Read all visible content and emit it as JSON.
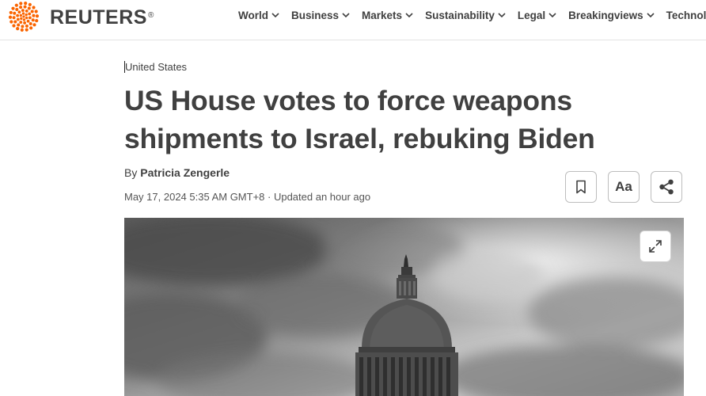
{
  "brand": {
    "name": "REUTERS",
    "registered_mark": "®",
    "accent_color": "#fa6400"
  },
  "nav": {
    "items": [
      {
        "label": "World"
      },
      {
        "label": "Business"
      },
      {
        "label": "Markets"
      },
      {
        "label": "Sustainability"
      },
      {
        "label": "Legal"
      },
      {
        "label": "Breakingviews"
      },
      {
        "label": "Technology"
      }
    ]
  },
  "article": {
    "kicker": "United States",
    "headline_line1": "US House votes to force weapons",
    "headline_line2": "shipments to Israel, rebuking Biden",
    "byline_prefix": "By",
    "author": "Patricia Zengerle",
    "dateline": "May 17, 2024 5:35 AM GMT+8 · Updated an hour ago"
  },
  "actions": {
    "bookmark_icon": "bookmark-icon",
    "font_size_label": "Aa",
    "share_icon": "share-icon"
  },
  "photo": {
    "subject": "capitol-dome",
    "expand_icon": "expand-icon"
  }
}
